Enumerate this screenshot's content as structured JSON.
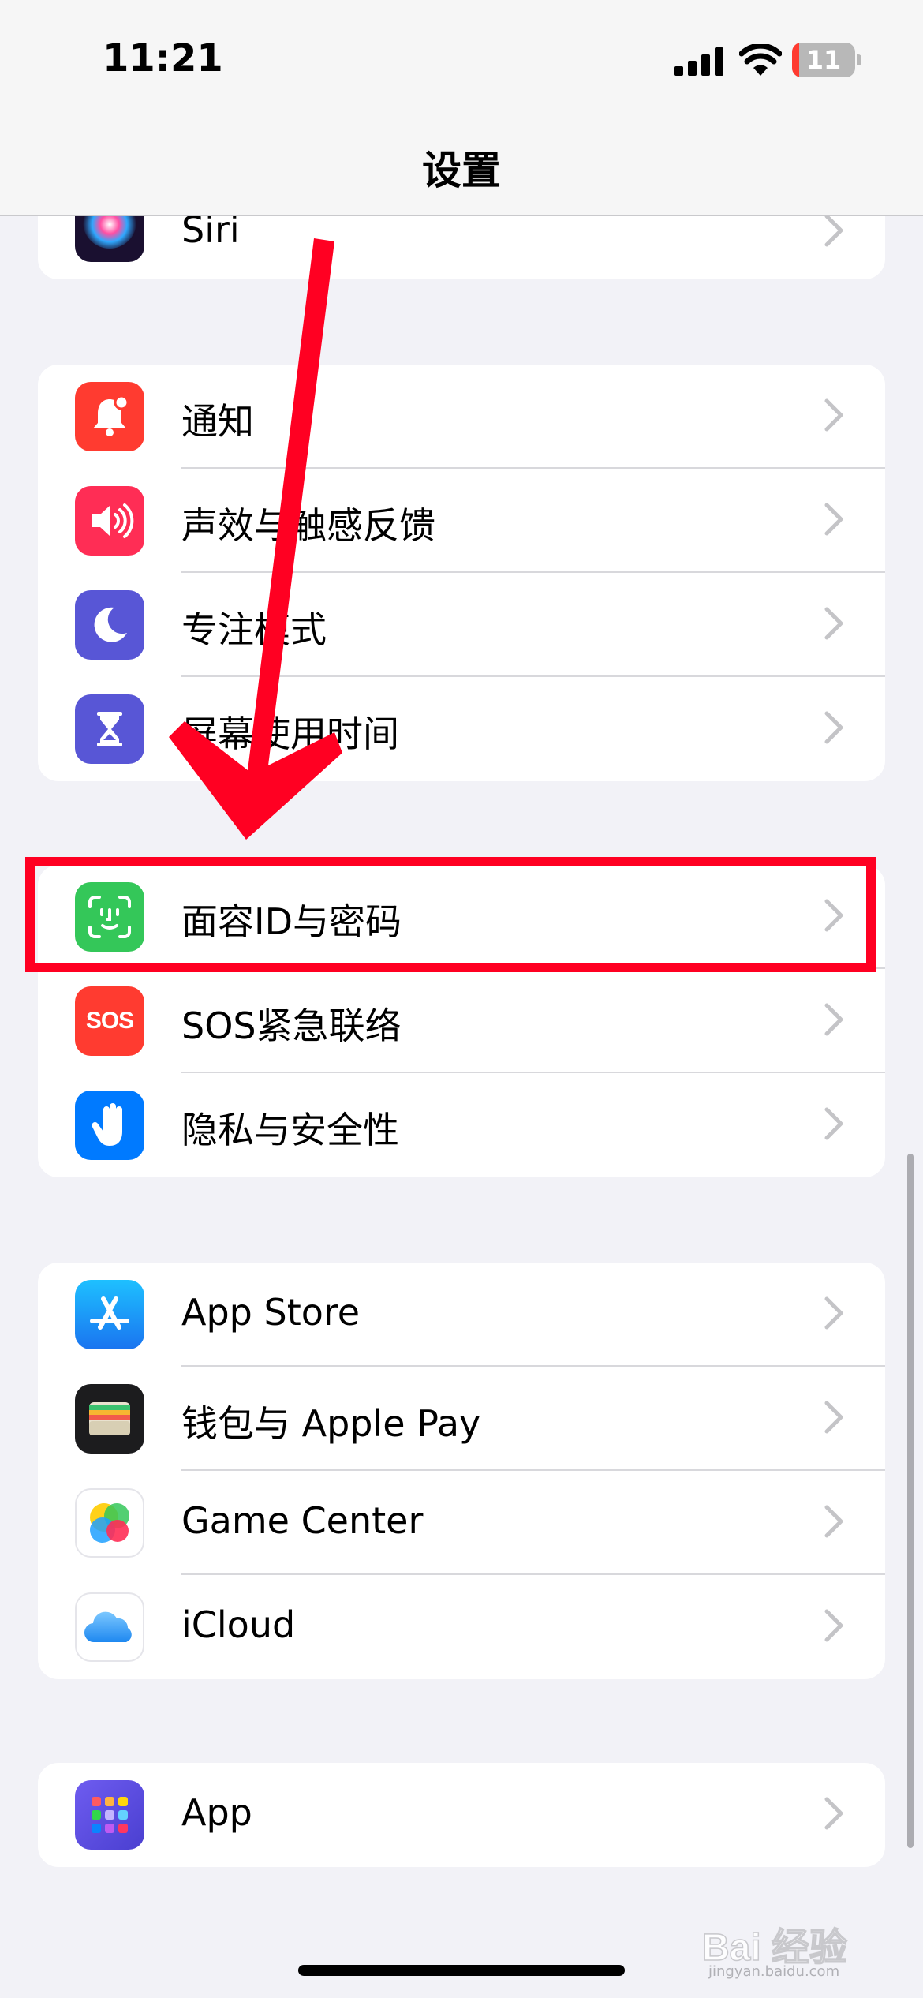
{
  "status_bar": {
    "time": "11:21",
    "battery_level": "11",
    "battery_fraction": 0.11
  },
  "nav": {
    "title": "设置"
  },
  "groups": [
    {
      "id": "siri",
      "items": [
        {
          "label": "Siri",
          "icon": "siri-icon"
        }
      ]
    },
    {
      "id": "notifications",
      "items": [
        {
          "label": "通知",
          "icon": "notification-bell-icon",
          "color": "#ff3b30"
        },
        {
          "label": "声效与触感反馈",
          "icon": "speaker-icon",
          "color": "#ff2d55"
        },
        {
          "label": "专注模式",
          "icon": "moon-icon",
          "color": "#5856d6"
        },
        {
          "label": "屏幕使用时间",
          "icon": "hourglass-icon",
          "color": "#5856d6"
        }
      ]
    },
    {
      "id": "security",
      "items": [
        {
          "label": "面容ID与密码",
          "icon": "face-id-icon",
          "color": "#34c759"
        },
        {
          "label": "SOS紧急联络",
          "icon": "sos-icon",
          "color": "#ff3b30",
          "icon_text": "SOS"
        },
        {
          "label": "隐私与安全性",
          "icon": "hand-icon",
          "color": "#007aff"
        }
      ]
    },
    {
      "id": "store",
      "items": [
        {
          "label": "App Store",
          "icon": "app-store-icon",
          "color": "#1a8cff"
        },
        {
          "label": "钱包与 Apple Pay",
          "icon": "wallet-icon",
          "color": "#1c1c1e"
        },
        {
          "label": "Game Center",
          "icon": "game-center-icon",
          "color": "#ffffff"
        },
        {
          "label": "iCloud",
          "icon": "icloud-icon",
          "color": "#ffffff"
        }
      ]
    },
    {
      "id": "apps",
      "items": [
        {
          "label": "App",
          "icon": "app-grid-icon",
          "color": "#5e5ce6"
        }
      ]
    }
  ],
  "annotation": {
    "arrow_color": "#ff0022",
    "highlight_color": "#ff0022"
  },
  "watermark": {
    "text": "Bai 经验",
    "subtext": "jingyan.baidu.com"
  }
}
